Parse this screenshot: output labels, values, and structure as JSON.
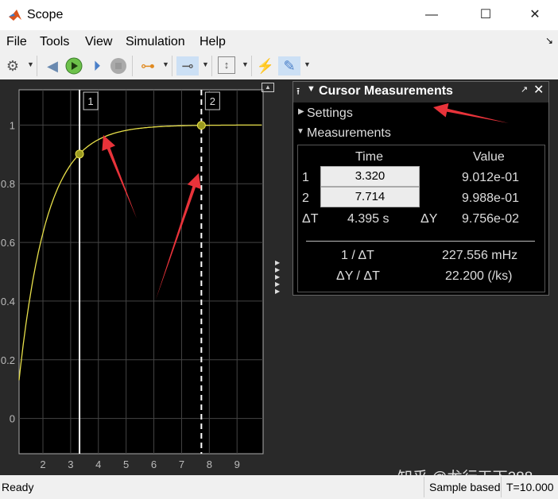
{
  "window": {
    "title": "Scope",
    "minimize": "—",
    "maximize": "☐",
    "close": "✕"
  },
  "menu": [
    "File",
    "Tools",
    "View",
    "Simulation",
    "Help"
  ],
  "menu_arrow": "↘",
  "toolbar": {
    "icons": [
      "gear-icon",
      "step-back-icon",
      "run-icon",
      "step-forward-icon",
      "stop-icon",
      "signal-select-icon",
      "zoom-x-icon",
      "scale-axes-icon",
      "triggers-icon",
      "cursor-measurements-icon"
    ]
  },
  "plot": {
    "xticks": [
      "2",
      "3",
      "4",
      "5",
      "6",
      "7",
      "8",
      "9"
    ],
    "yticks": [
      "1",
      "0.8",
      "0.6",
      "0.4",
      "0.2",
      "0"
    ],
    "cursor1_label": "1",
    "cursor2_label": "2",
    "line_color": "#e8e04a",
    "xlim": [
      1.14,
      9.94
    ],
    "ylim": [
      -0.12,
      1.12
    ]
  },
  "panel": {
    "title": "Cursor Measurements",
    "settings": "Settings",
    "measurements": "Measurements",
    "time_header": "Time",
    "value_header": "Value",
    "row1_label": "1",
    "row1_time": "3.320",
    "row1_value": "9.012e-01",
    "row2_label": "2",
    "row2_time": "7.714",
    "row2_value": "9.988e-01",
    "dt_label": "ΔT",
    "dt_value": "4.395 s",
    "dy_label": "ΔY",
    "dy_value": "9.756e-02",
    "inv_dt_label": "1 / ΔT",
    "inv_dt_value": "227.556 mHz",
    "slope_label": "ΔY / ΔT",
    "slope_value": "22.200 (/ks)"
  },
  "status": {
    "ready": "Ready",
    "mode": "Sample based",
    "time": "T=10.000"
  },
  "watermark": "知乎 @龙行天下288"
}
